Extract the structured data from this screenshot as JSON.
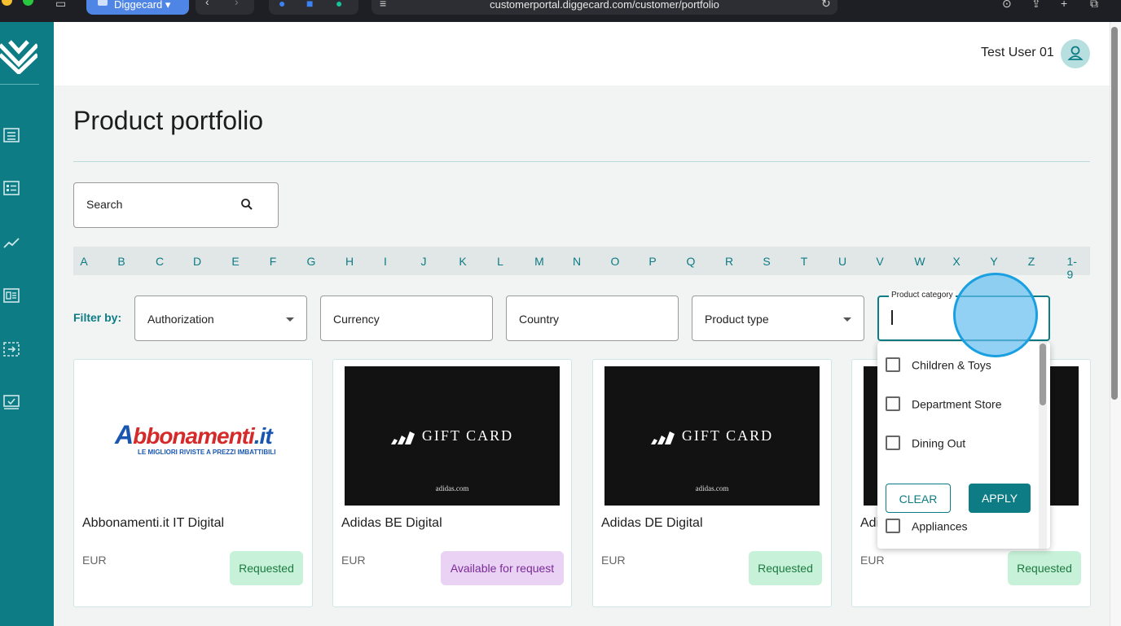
{
  "browser": {
    "tab_label": "Diggecard",
    "url": "customerportal.diggecard.com/customer/portfolio"
  },
  "header": {
    "user_name": "Test User 01"
  },
  "page": {
    "title": "Product portfolio"
  },
  "search": {
    "placeholder": "Search"
  },
  "alphabet": [
    "A",
    "B",
    "C",
    "D",
    "E",
    "F",
    "G",
    "H",
    "I",
    "J",
    "K",
    "L",
    "M",
    "N",
    "O",
    "P",
    "Q",
    "R",
    "S",
    "T",
    "U",
    "V",
    "W",
    "X",
    "Y",
    "Z",
    "1-9"
  ],
  "filters": {
    "label": "Filter by:",
    "authorization": "Authorization",
    "currency": "Currency",
    "country": "Country",
    "product_type": "Product type",
    "product_category_label": "Product category"
  },
  "dropdown": {
    "options": [
      "Children & Toys",
      "Department Store",
      "Dining Out",
      "Appliances"
    ],
    "clear_label": "CLEAR",
    "apply_label": "APPLY"
  },
  "products": [
    {
      "name": "Abbonamenti.it IT Digital",
      "currency": "EUR",
      "status": "Requested",
      "logo_text": "Abbonamenti.it",
      "logo_tagline": "LE MIGLIORI RIVISTE A PREZZI IMBATTIBILI"
    },
    {
      "name": "Adidas BE Digital",
      "currency": "EUR",
      "status": "Available for request",
      "card_text": "GIFT CARD",
      "card_sub": "adidas.com"
    },
    {
      "name": "Adidas DE Digital",
      "currency": "EUR",
      "status": "Requested",
      "card_text": "GIFT CARD",
      "card_sub": "adidas.com"
    },
    {
      "name": "Adi",
      "currency": "EUR",
      "status": "Requested"
    }
  ],
  "colors": {
    "brand": "#0d7c84",
    "requested_bg": "#c7f1d8",
    "available_bg": "#e9d2f4"
  }
}
